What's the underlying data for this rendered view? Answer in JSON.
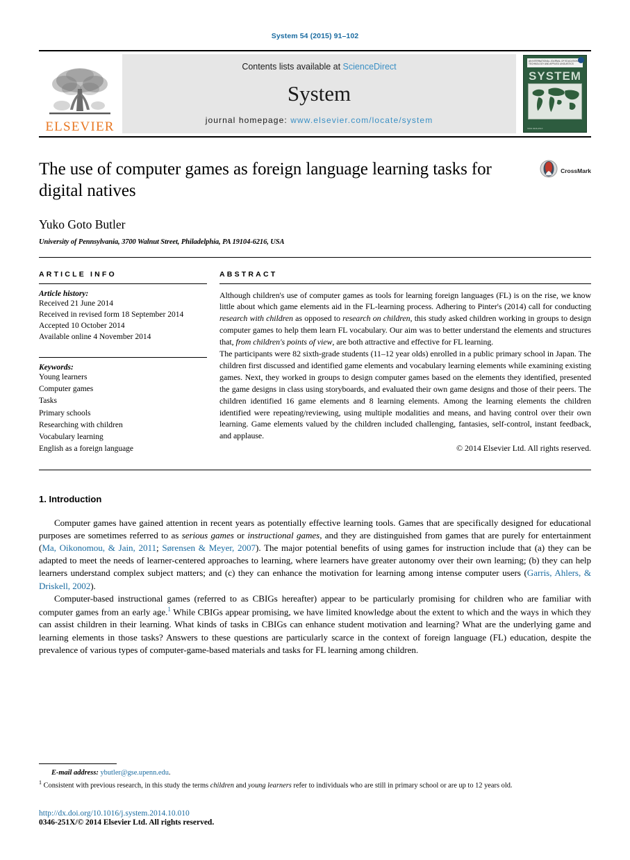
{
  "running_head": "System 54 (2015) 91–102",
  "masthead": {
    "publisher_logo_text": "ELSEVIER",
    "contents_prefix": "Contents lists available at ",
    "contents_link": "ScienceDirect",
    "journal_name": "System",
    "homepage_prefix": "journal homepage: ",
    "homepage_url": "www.elsevier.com/locate/system",
    "cover": {
      "title": "SYSTEM",
      "header_text": "AN INTERNATIONAL JOURNAL OF EDUCATIONAL TECHNOLOGY AND APPLIED LINGUISTICS",
      "footer_text": "ISSN 0346-251X"
    }
  },
  "article": {
    "title": "The use of computer games as foreign language learning tasks for digital natives",
    "crossmark_label": "CrossMark",
    "author": "Yuko Goto Butler",
    "affiliation": "University of Pennsylvania, 3700 Walnut Street, Philadelphia, PA 19104-6216, USA"
  },
  "article_info": {
    "heading": "ARTICLE INFO",
    "history_label": "Article history:",
    "history": [
      "Received 21 June 2014",
      "Received in revised form 18 September 2014",
      "Accepted 10 October 2014",
      "Available online 4 November 2014"
    ],
    "keywords_label": "Keywords:",
    "keywords": [
      "Young learners",
      "Computer games",
      "Tasks",
      "Primary schools",
      "Researching with children",
      "Vocabulary learning",
      "English as a foreign language"
    ]
  },
  "abstract": {
    "heading": "ABSTRACT",
    "paragraph1_a": "Although children's use of computer games as tools for learning foreign languages (FL) is on the rise, we know little about which game elements aid in the FL-learning process. Adhering to Pinter's (2014) call for conducting ",
    "paragraph1_it1": "research with children",
    "paragraph1_b": " as opposed to ",
    "paragraph1_it2": "research on children",
    "paragraph1_c": ", this study asked children working in groups to design computer games to help them learn FL vocabulary. Our aim was to better understand the elements and structures that, ",
    "paragraph1_it3": "from children's points of view",
    "paragraph1_d": ", are both attractive and effective for FL learning.",
    "paragraph2": "The participants were 82 sixth-grade students (11–12 year olds) enrolled in a public primary school in Japan. The children first discussed and identified game elements and vocabulary learning elements while examining existing games. Next, they worked in groups to design computer games based on the elements they identified, presented the game designs in class using storyboards, and evaluated their own game designs and those of their peers. The children identified 16 game elements and 8 learning elements. Among the learning elements the children identified were repeating/reviewing, using multiple modalities and means, and having control over their own learning. Game elements valued by the children included challenging, fantasies, self-control, instant feedback, and applause.",
    "copyright": "© 2014 Elsevier Ltd. All rights reserved."
  },
  "introduction": {
    "heading": "1. Introduction",
    "p1_a": "Computer games have gained attention in recent years as potentially effective learning tools. Games that are specifically designed for educational purposes are sometimes referred to as ",
    "p1_it1": "serious games",
    "p1_b": " or ",
    "p1_it2": "instructional games",
    "p1_c": ", and they are distinguished from games that are purely for entertainment (",
    "p1_cite1": "Ma, Oikonomou, & Jain, 2011",
    "p1_d": "; ",
    "p1_cite2": "Sørensen & Meyer, 2007",
    "p1_e": "). The major potential benefits of using games for instruction include that (a) they can be adapted to meet the needs of learner-centered approaches to learning, where learners have greater autonomy over their own learning; (b) they can help learners understand complex subject matters; and (c) they can enhance the motivation for learning among intense computer users (",
    "p1_cite3": "Garris, Ahlers, & Driskell, 2002",
    "p1_f": ").",
    "p2_a": "Computer-based instructional games (referred to as CBIGs hereafter) appear to be particularly promising for children who are familiar with computer games from an early age.",
    "p2_footnote_marker": "1",
    "p2_b": " While CBIGs appear promising, we have limited knowledge about the extent to which and the ways in which they can assist children in their learning. What kinds of tasks in CBIGs can enhance student motivation and learning? What are the underlying game and learning elements in those tasks? Answers to these questions are particularly scarce in the context of foreign language (FL) education, despite the prevalence of various types of computer-game-based materials and tasks for FL learning among children."
  },
  "footnotes": {
    "email_label": "E-mail address:",
    "email": "ybutler@gse.upenn.edu",
    "email_suffix": ".",
    "note_marker": "1",
    "note_a": " Consistent with previous research, in this study the terms ",
    "note_it1": "children",
    "note_b": " and ",
    "note_it2": "young learners",
    "note_c": " refer to individuals who are still in primary school or are up to 12 years old.",
    "doi": "http://dx.doi.org/10.1016/j.system.2014.10.010",
    "issn": "0346-251X/© 2014 Elsevier Ltd. All rights reserved."
  },
  "colors": {
    "link": "#1a6ba0",
    "sciencedirect": "#3a8fc4",
    "elsevier_orange": "#E87722",
    "cover_green": "#2d5c3f"
  }
}
